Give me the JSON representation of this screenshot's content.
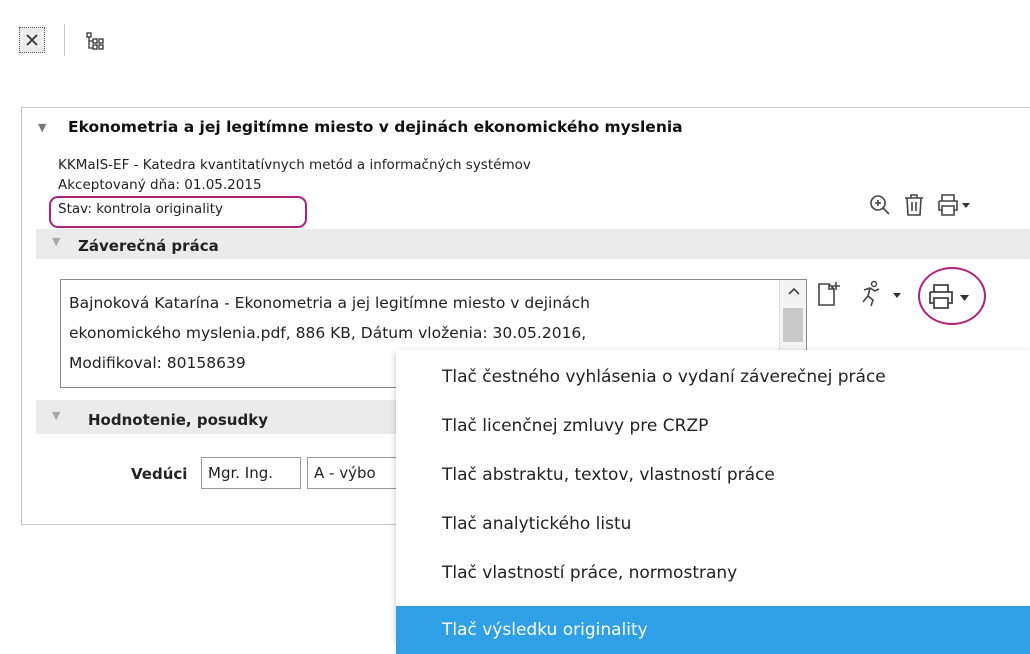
{
  "toolbar": {
    "close_icon": "close-icon",
    "tree_icon": "hierarchy-icon"
  },
  "thesis": {
    "title": "Ekonometria a jej legitímne miesto v dejinách ekonomického myslenia",
    "department": "KKMaIS-EF - Katedra kvantitatívnych metód a informačných systémov",
    "accepted": "Akceptovaný dňa: 01.05.2015",
    "status": "Stav: kontrola originality",
    "actions": [
      "zoom-in-icon",
      "trash-icon",
      "print-icon"
    ]
  },
  "final_work": {
    "heading": "Záverečná práca",
    "file_lines": [
      "Bajnoková Katarína - Ekonometria a jej legitímne miesto v dejinách",
      "ekonomického myslenia.pdf, 886 KB, Dátum vloženia: 30.05.2016,",
      "Modifikoval: 80158639"
    ],
    "actions": [
      "new-document-icon",
      "runner-icon",
      "print-icon"
    ]
  },
  "evaluation": {
    "heading": "Hodnotenie, posudky",
    "supervisor_label": "Vedúci",
    "supervisor_name": "Mgr. Ing.",
    "grade": "A - výbo"
  },
  "print_menu": {
    "items": [
      "Tlač čestného vyhlásenia o vydaní záverečnej práce",
      "Tlač licenčnej zmluvy pre CRZP",
      "Tlač abstraktu, textov, vlastností práce",
      "Tlač analytického listu",
      "Tlač vlastností práce, normostrany",
      "Tlač výsledku originality"
    ],
    "selected": "Tlač výsledku originality"
  },
  "colors": {
    "highlight_ring": "#b1207a",
    "menu_selected": "#2f9fe6",
    "section_band": "#ebebeb"
  }
}
